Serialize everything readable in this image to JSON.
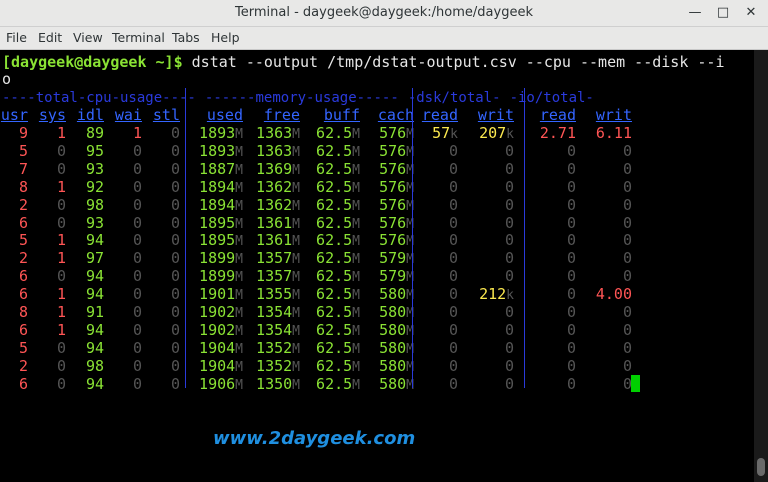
{
  "window": {
    "title": "Terminal - daygeek@daygeek:/home/daygeek"
  },
  "menu": [
    "File",
    "Edit",
    "View",
    "Terminal",
    "Tabs",
    "Help"
  ],
  "prompt": {
    "user": "[daygeek@daygeek ~]$",
    "command": " dstat --output /tmp/dstat-output.csv --cpu --mem --disk --i",
    "wrap": "o"
  },
  "groups": [
    "----total-cpu-usage----",
    "------memory-usage-----",
    "-dsk/total-",
    "-io/total-"
  ],
  "headers": [
    "usr",
    "sys",
    "idl",
    "wai",
    "stl",
    "used",
    "free",
    "buff",
    "cach",
    "read",
    "writ",
    "read",
    "writ"
  ],
  "rows": [
    [
      "9",
      "1",
      "89",
      "1",
      "0",
      "1893",
      "1363",
      "62.5",
      "576",
      "57",
      "207",
      "2.71",
      "6.11"
    ],
    [
      "5",
      "0",
      "95",
      "0",
      "0",
      "1893",
      "1363",
      "62.5",
      "576",
      "0",
      "0",
      "0",
      "0"
    ],
    [
      "7",
      "0",
      "93",
      "0",
      "0",
      "1887",
      "1369",
      "62.5",
      "576",
      "0",
      "0",
      "0",
      "0"
    ],
    [
      "8",
      "1",
      "92",
      "0",
      "0",
      "1894",
      "1362",
      "62.5",
      "576",
      "0",
      "0",
      "0",
      "0"
    ],
    [
      "2",
      "0",
      "98",
      "0",
      "0",
      "1894",
      "1362",
      "62.5",
      "576",
      "0",
      "0",
      "0",
      "0"
    ],
    [
      "6",
      "0",
      "93",
      "0",
      "0",
      "1895",
      "1361",
      "62.5",
      "576",
      "0",
      "0",
      "0",
      "0"
    ],
    [
      "5",
      "1",
      "94",
      "0",
      "0",
      "1895",
      "1361",
      "62.5",
      "576",
      "0",
      "0",
      "0",
      "0"
    ],
    [
      "2",
      "1",
      "97",
      "0",
      "0",
      "1899",
      "1357",
      "62.5",
      "579",
      "0",
      "0",
      "0",
      "0"
    ],
    [
      "6",
      "0",
      "94",
      "0",
      "0",
      "1899",
      "1357",
      "62.5",
      "579",
      "0",
      "0",
      "0",
      "0"
    ],
    [
      "6",
      "1",
      "94",
      "0",
      "0",
      "1901",
      "1355",
      "62.5",
      "580",
      "0",
      "212",
      "0",
      "4.00"
    ],
    [
      "8",
      "1",
      "91",
      "0",
      "0",
      "1902",
      "1354",
      "62.5",
      "580",
      "0",
      "0",
      "0",
      "0"
    ],
    [
      "6",
      "1",
      "94",
      "0",
      "0",
      "1902",
      "1354",
      "62.5",
      "580",
      "0",
      "0",
      "0",
      "0"
    ],
    [
      "5",
      "0",
      "94",
      "0",
      "0",
      "1904",
      "1352",
      "62.5",
      "580",
      "0",
      "0",
      "0",
      "0"
    ],
    [
      "2",
      "0",
      "98",
      "0",
      "0",
      "1904",
      "1352",
      "62.5",
      "580",
      "0",
      "0",
      "0",
      "0"
    ],
    [
      "6",
      "0",
      "94",
      "0",
      "0",
      "1906",
      "1350",
      "62.5",
      "580",
      "0",
      "0",
      "0",
      "0"
    ]
  ],
  "units": {
    "mem": "M",
    "kilo": "k"
  },
  "watermark": "www.2daygeek.com"
}
